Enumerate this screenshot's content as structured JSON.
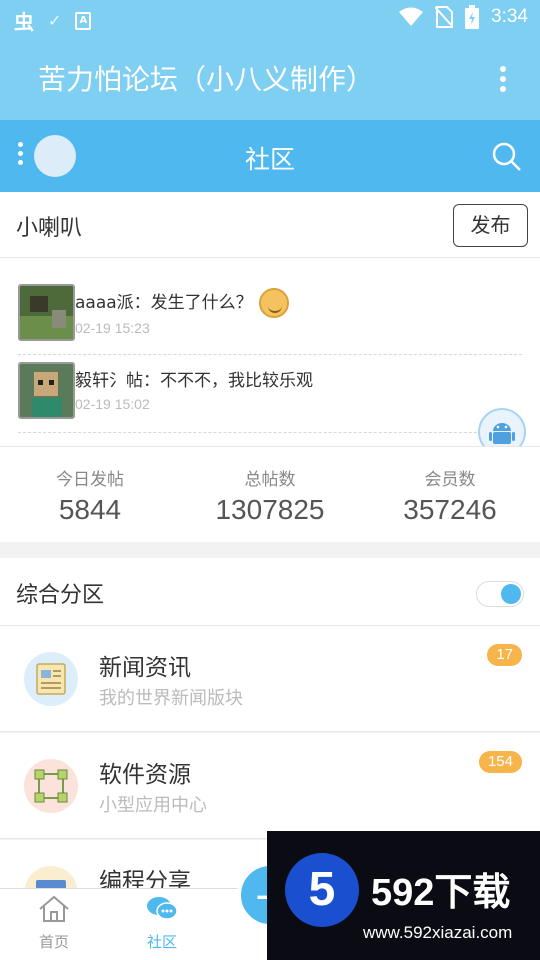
{
  "status_bar": {
    "time": "3:34",
    "left_icons": [
      "bug-icon",
      "check-icon",
      "a-box-icon"
    ],
    "right_icons": [
      "wifi-icon",
      "no-sim-icon",
      "battery-icon"
    ]
  },
  "app": {
    "title": "苦力怕论坛（小八义制作）"
  },
  "community_bar": {
    "title": "社区"
  },
  "horn": {
    "title": "小喇叭",
    "post_button": "发布",
    "items": [
      {
        "text": "aaaa派：发生了什么？",
        "time": "02-19 15:23"
      },
      {
        "text": "毅轩氵帖：不不不，我比较乐观",
        "time": "02-19 15:02"
      }
    ]
  },
  "stats": [
    {
      "label": "今日发帖",
      "value": "5844"
    },
    {
      "label": "总帖数",
      "value": "1307825"
    },
    {
      "label": "会员数",
      "value": "357246"
    }
  ],
  "category": {
    "title": "综合分区",
    "toggle_on": true
  },
  "forums": [
    {
      "name": "新闻资讯",
      "desc": "我的世界新闻版块",
      "badge": "17",
      "icon": "newspaper-icon"
    },
    {
      "name": "软件资源",
      "desc": "小型应用中心",
      "badge": "154",
      "icon": "nodes-icon"
    },
    {
      "name": "编程分享",
      "desc": "",
      "badge": "",
      "icon": "code-icon"
    }
  ],
  "bottom_nav": [
    {
      "label": "首页",
      "icon": "home-icon"
    },
    {
      "label": "社区",
      "icon": "chat-icon"
    }
  ],
  "watermark": {
    "brand": "592下载",
    "url": "www.592xiazai.com",
    "logo_digit": "5"
  },
  "colors": {
    "title_bar": "#7fcff3",
    "accent": "#4fb8ef",
    "badge": "#f6b44b"
  }
}
